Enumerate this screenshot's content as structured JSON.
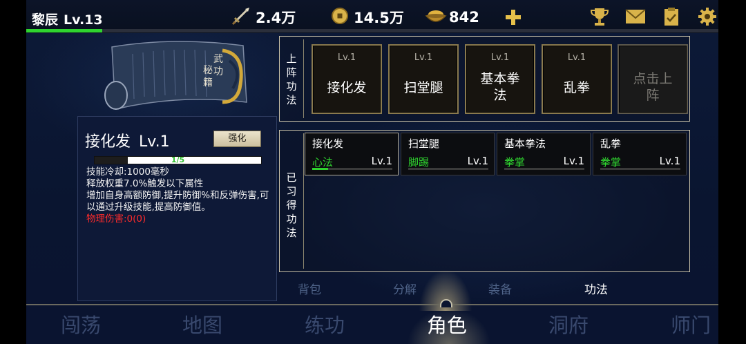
{
  "player": {
    "name": "黎辰",
    "level": "Lv.13",
    "exp_fraction": 0.11
  },
  "resources": {
    "attack": {
      "icon": "sword-icon",
      "value": "2.4万"
    },
    "coins": {
      "icon": "coin-icon",
      "value": "14.5万"
    },
    "ingots": {
      "icon": "ingot-bowl-icon",
      "value": "842"
    },
    "add_icon": "plus-icon"
  },
  "top_icons": [
    "trophy-icon",
    "mail-icon",
    "clipboard-icon",
    "gear-icon"
  ],
  "scroll_art": {
    "title": "武功秘籍"
  },
  "skill_detail": {
    "name": "接化发",
    "level": "Lv.1",
    "upgrade_label": "强化",
    "progress_text": "1/5",
    "progress_fraction": 0.2,
    "description": [
      "技能冷却:1000毫秒",
      "释放权重7.0%触发以下属性",
      "增加自身高额防御,提升防御%和反弹伤害,可以通过升级技能,提高防御值。"
    ],
    "damage": "物理伤害:0(0)"
  },
  "equipped": {
    "label": "上阵功法",
    "slots": [
      {
        "level": "Lv.1",
        "name": "接化发"
      },
      {
        "level": "Lv.1",
        "name": "扫堂腿"
      },
      {
        "level": "Lv.1",
        "name": "基本拳法"
      },
      {
        "level": "Lv.1",
        "name": "乱拳"
      },
      {
        "level": "",
        "name": "点击上阵"
      }
    ]
  },
  "learned": {
    "label": "已习得功法",
    "skills": [
      {
        "name": "接化发",
        "type": "心法",
        "level": "Lv.1",
        "progress": 0.2
      },
      {
        "name": "扫堂腿",
        "type": "脚踢",
        "level": "Lv.1",
        "progress": 0
      },
      {
        "name": "基本拳法",
        "type": "拳掌",
        "level": "Lv.1",
        "progress": 0
      },
      {
        "name": "乱拳",
        "type": "拳掌",
        "level": "Lv.1",
        "progress": 0
      }
    ]
  },
  "sub_tabs": [
    {
      "label": "背包",
      "active": false
    },
    {
      "label": "分解",
      "active": false
    },
    {
      "label": "装备",
      "active": false
    },
    {
      "label": "功法",
      "active": true
    }
  ],
  "bottom_nav": [
    {
      "label": "闯荡",
      "active": false
    },
    {
      "label": "地图",
      "active": false
    },
    {
      "label": "练功",
      "active": false
    },
    {
      "label": "角色",
      "active": true
    },
    {
      "label": "洞府",
      "active": false
    },
    {
      "label": "师门",
      "active": false
    }
  ],
  "colors": {
    "accent_green": "#2fd42f",
    "damage_red": "#ff2b2b",
    "gold_border": "#8a7a4e"
  }
}
